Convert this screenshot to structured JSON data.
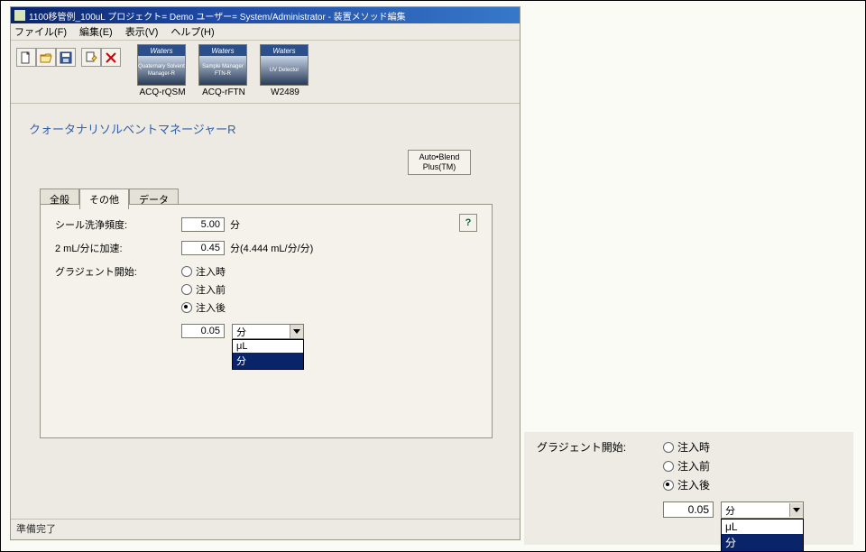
{
  "titlebar": "1100移管例_100uL プロジェクト= Demo ユーザー= System/Administrator - 装置メソッド編集",
  "menu": {
    "file": "ファイル(F)",
    "edit": "編集(E)",
    "view": "表示(V)",
    "help": "ヘルプ(H)"
  },
  "devices": [
    {
      "brand": "Waters",
      "sub": "Quaternary Solvent Manager-R",
      "label": "ACQ-rQSM"
    },
    {
      "brand": "Waters",
      "sub": "Sample Manager FTN-R",
      "label": "ACQ-rFTN"
    },
    {
      "brand": "Waters",
      "sub": "UV Detector",
      "label": "W2489"
    }
  ],
  "panel": {
    "title": "クォータナリソルベントマネージャーR",
    "autoblend": "Auto•Blend Plus(TM)"
  },
  "tabs": {
    "general": "全般",
    "other": "その他",
    "data": "データ"
  },
  "fields": {
    "sealwash_label": "シール洗浄頻度:",
    "sealwash_value": "5.00",
    "sealwash_unit": "分",
    "accel_label": "2 mL/分に加速:",
    "accel_value": "0.45",
    "accel_unit": "分(4.444 mL/分/分)",
    "gradstart_label": "グラジェント開始:",
    "radios": {
      "r1": "注入時",
      "r2": "注入前",
      "r3": "注入後"
    },
    "grad_delay_value": "0.05",
    "combo_sel": "分",
    "combo_opts": {
      "a": "μL",
      "b": "分"
    }
  },
  "help": "?",
  "status": "準備完了"
}
